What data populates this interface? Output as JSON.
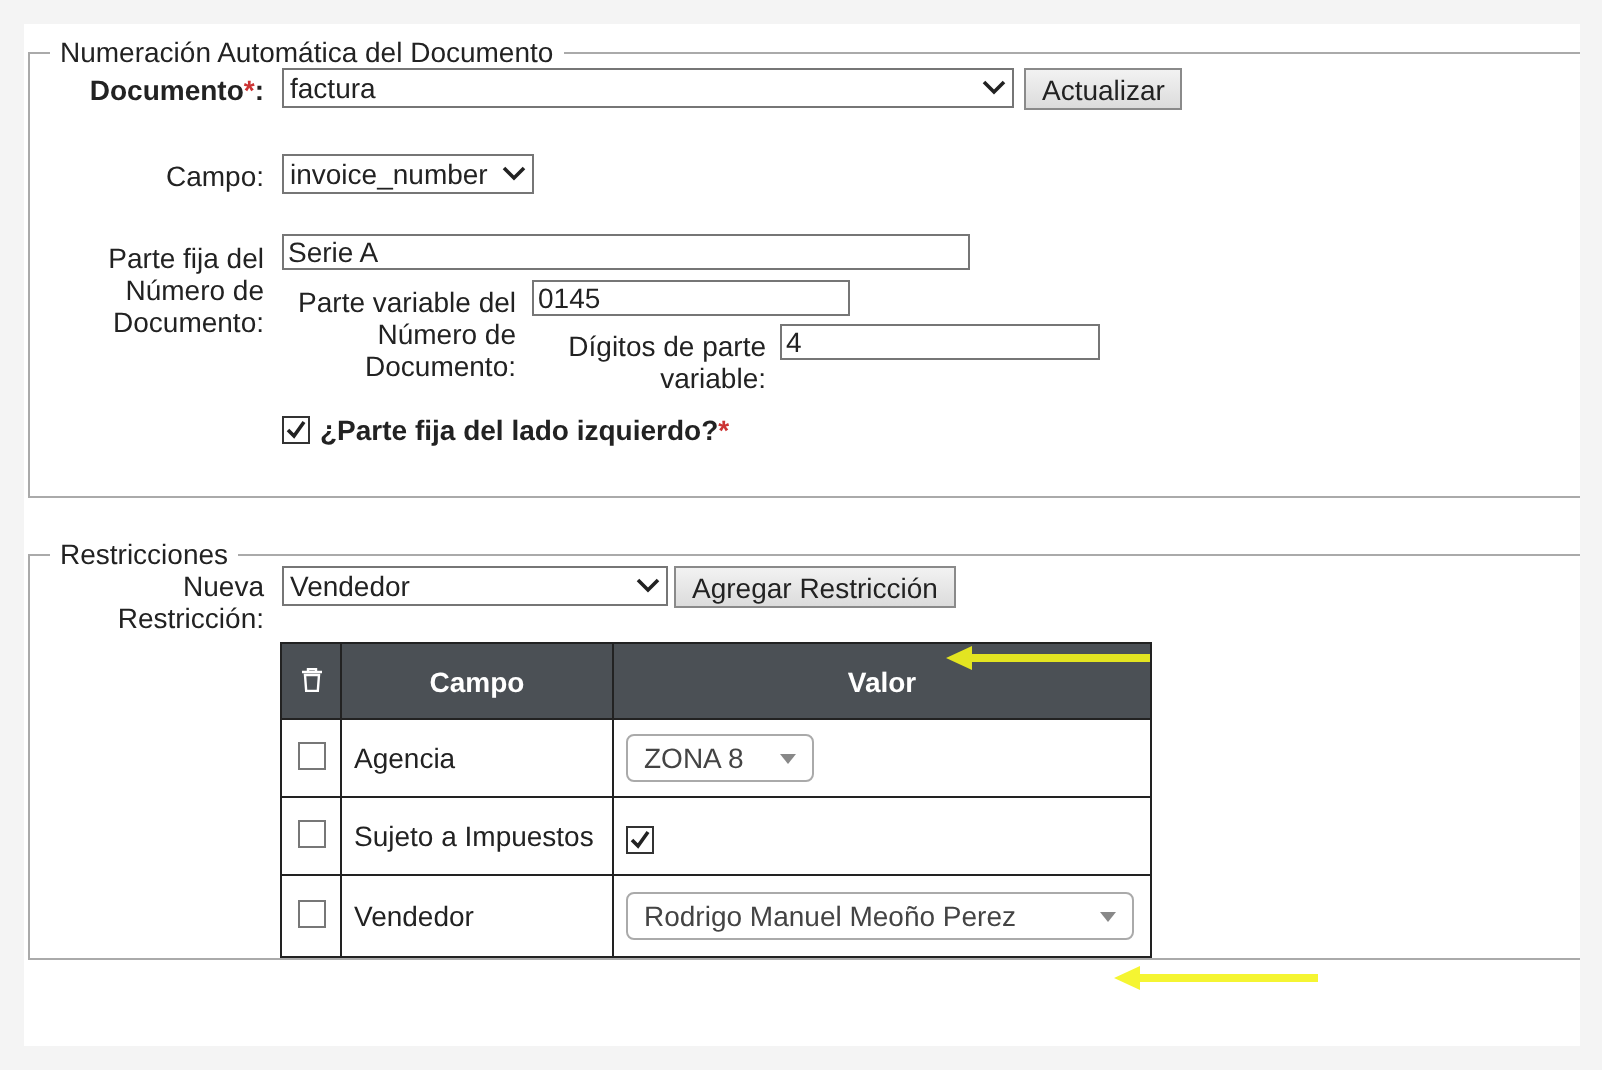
{
  "numbering": {
    "legend": "Numeración Automática del Documento",
    "document": {
      "label": "Documento",
      "required_mark": "*",
      "colon": ":",
      "value": "factura",
      "button": "Actualizar"
    },
    "field": {
      "label": "Campo:",
      "value": "invoice_number"
    },
    "fixed_part": {
      "label": "Parte fija del Número de Documento:",
      "value": "Serie A"
    },
    "variable_part": {
      "label": "Parte variable del Número de Documento:",
      "value": "0145"
    },
    "digits": {
      "label": "Dígitos de parte variable:",
      "value": "4"
    },
    "fixed_left": {
      "label": "¿Parte fija del lado izquierdo?",
      "required_mark": "*",
      "checked": true
    }
  },
  "restrictions": {
    "legend": "Restricciones",
    "new_restriction": {
      "label": "Nueva Restricción:",
      "value": "Vendedor",
      "button": "Agregar Restricción"
    },
    "table": {
      "columns": [
        "Campo",
        "Valor"
      ],
      "rows": [
        {
          "checked": false,
          "field": "Agencia",
          "kind": "select",
          "value": "ZONA 8"
        },
        {
          "checked": false,
          "field": "Sujeto a Impuestos",
          "kind": "checkbox",
          "value_checked": true
        },
        {
          "checked": false,
          "field": "Vendedor",
          "kind": "select",
          "value": "Rodrigo Manuel Meoño Perez"
        }
      ]
    }
  }
}
